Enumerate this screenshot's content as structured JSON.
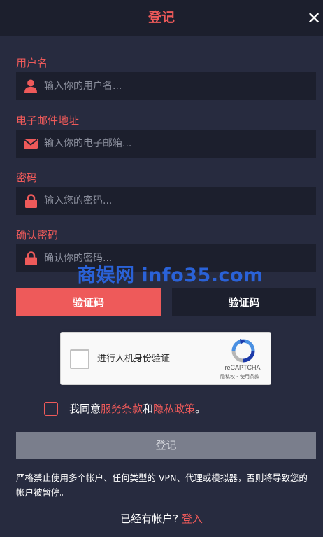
{
  "header": {
    "title": "登记",
    "close": "✕"
  },
  "form": {
    "username": {
      "label": "用户名",
      "placeholder": "输入你的用户名...",
      "icon": "user-icon"
    },
    "email": {
      "label": "电子邮件地址",
      "placeholder": "输入你的电子邮箱...",
      "icon": "envelope-icon"
    },
    "password": {
      "label": "密码",
      "placeholder": "输入您的密码...",
      "icon": "lock-icon"
    },
    "confirm": {
      "label": "确认密码",
      "placeholder": "确认你的密码...",
      "icon": "lock-icon"
    }
  },
  "verify": {
    "left_label": "验证码",
    "right_label": "验证码"
  },
  "watermark": "商娱网 info35.com",
  "captcha": {
    "label": "进行人机身份验证",
    "brand": "reCAPTCHA",
    "links": "隐私权 - 使用条款"
  },
  "agree": {
    "prefix": "我同意",
    "terms": "服务条款",
    "and": "和",
    "privacy": "隐私政策",
    "suffix": "。"
  },
  "submit_label": "登记",
  "disclaimer": "严格禁止使用多个帐户、任何类型的 VPN、代理或模拟器，否则将导致您的帐户被暂停。",
  "footer": {
    "question": "已经有帐户?",
    "login": "登入"
  },
  "colors": {
    "accent": "#ee5a5a",
    "background": "#272b3f",
    "panel": "#1c1f2d",
    "disabled": "#7a7e8c"
  }
}
